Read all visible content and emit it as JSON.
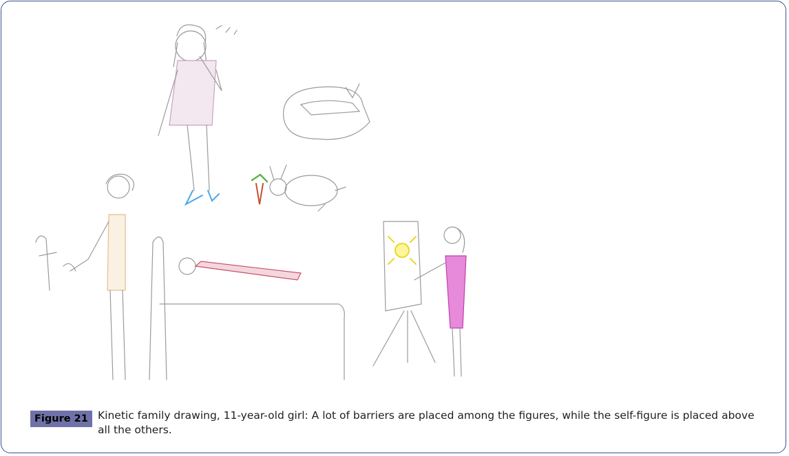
{
  "figure": {
    "label": "Figure 21",
    "caption": "Kinetic family drawing, 11-year-old girl: A lot of barriers are placed among the figures, while the self-figure is placed above all the others."
  }
}
